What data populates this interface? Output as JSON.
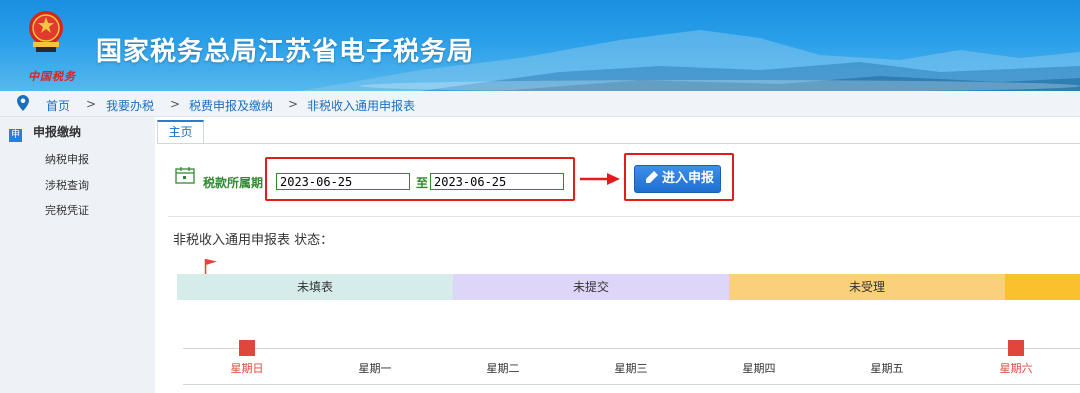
{
  "header": {
    "site_title": "国家税务总局江苏省电子税务局",
    "emblem_script": "中国税务"
  },
  "breadcrumb": {
    "items": [
      "首页",
      "我要办税",
      "税费申报及缴纳",
      "非税收入通用申报表"
    ],
    "separator": ">"
  },
  "sidebar": {
    "section_icon": "申",
    "section_title": "申报缴纳",
    "items": [
      "纳税申报",
      "涉税查询",
      "完税凭证"
    ]
  },
  "main": {
    "tab_label": "主页",
    "period_label": "税款所属期",
    "period_colon": "：",
    "start_date": "2023-06-25",
    "to_label": "至",
    "end_date": "2023-06-25",
    "enter_button_label": "进入申报",
    "status_title": "非税收入通用申报表 状态：",
    "status_segments": [
      {
        "label": "未填表",
        "color": "#d5eceb"
      },
      {
        "label": "未提交",
        "color": "#ddd6f8"
      },
      {
        "label": "未受理",
        "color": "#fbd07a"
      },
      {
        "label": "",
        "color": "#fbc02d"
      }
    ],
    "weekdays": [
      "星期日",
      "星期一",
      "星期二",
      "星期三",
      "星期四",
      "星期五",
      "星期六"
    ]
  },
  "colors": {
    "accent_blue": "#1e6fd0",
    "highlight_red": "#e21b1b",
    "label_green": "#2f8a2f",
    "weekend_red": "#e0463c"
  }
}
